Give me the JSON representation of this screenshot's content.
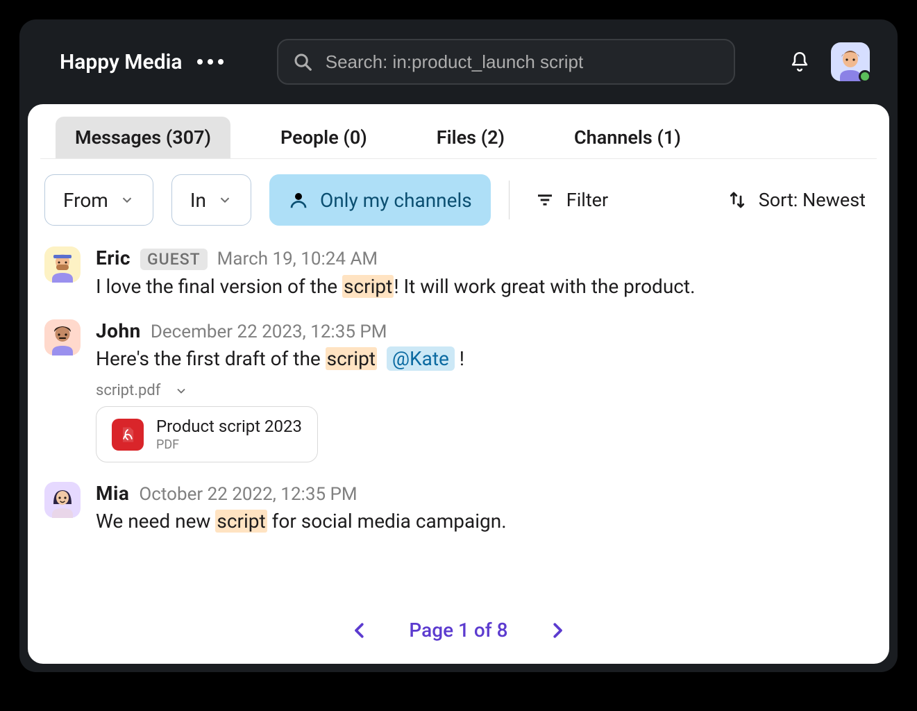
{
  "workspace": {
    "name": "Happy Media"
  },
  "search": {
    "display": "Search: in:product_launch script"
  },
  "tabs": [
    {
      "id": "messages",
      "label": "Messages (307)",
      "active": true
    },
    {
      "id": "people",
      "label": "People (0)",
      "active": false
    },
    {
      "id": "files",
      "label": "Files (2)",
      "active": false
    },
    {
      "id": "channels",
      "label": "Channels (1)",
      "active": false
    }
  ],
  "filters": {
    "from_label": "From",
    "in_label": "In",
    "only_my_channels": "Only my channels",
    "filter_label": "Filter",
    "sort_label": "Sort: Newest"
  },
  "results": [
    {
      "author": "Eric",
      "badge": "GUEST",
      "timestamp": "March 19, 10:24 AM",
      "avatar_class": "av-eric",
      "text_pre": "I love the final version of the ",
      "highlight": "script",
      "text_post": "! It will work great with the product."
    },
    {
      "author": "John",
      "timestamp": "December 22 2023, 12:35 PM",
      "avatar_class": "av-john",
      "text_pre": "Here's the first draft of the ",
      "highlight": "script",
      "mention": "@Kate",
      "text_post2": " !",
      "attachment": {
        "filename": "script.pdf",
        "title": "Product script 2023",
        "kind": "PDF"
      }
    },
    {
      "author": "Mia",
      "timestamp": "October 22 2022, 12:35 PM",
      "avatar_class": "av-mia",
      "text_pre": "We need new ",
      "highlight": "script",
      "text_post": " for social media campaign."
    }
  ],
  "pagination": {
    "label": "Page 1 of 8"
  }
}
